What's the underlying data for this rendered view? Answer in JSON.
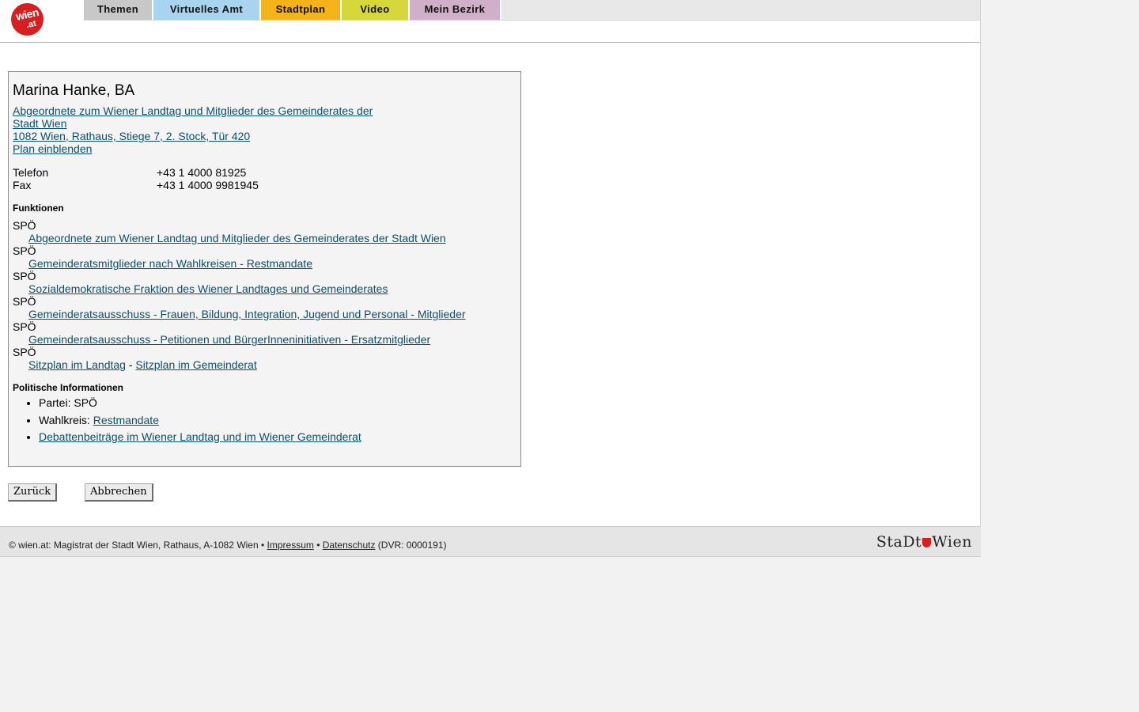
{
  "header": {
    "logo_text_top": "wien",
    "logo_text_bottom": ".at",
    "tabs": [
      {
        "label": "Themen",
        "color": "#c8c8c8"
      },
      {
        "label": "Virtuelles Amt",
        "color": "#a9d4f0"
      },
      {
        "label": "Stadtplan",
        "color": "#f5b31a"
      },
      {
        "label": "Video",
        "color": "#d6d83a"
      },
      {
        "label": "Mein Bezirk",
        "color": "#cfb0c8"
      }
    ]
  },
  "person": {
    "name": "Marina Hanke, BA",
    "org_line1": "Abgeordnete zum Wiener Landtag und Mitglieder des Gemeinderates der",
    "org_line2": "Stadt Wien ",
    "address": "1082 Wien, Rathaus, Stiege 7, 2. Stock, Tür 420",
    "map_link": "Plan einblenden",
    "phone_label": "Telefon",
    "phone": "+43 1 4000 81925",
    "fax_label": "Fax",
    "fax": "+43 1 4000 9981945"
  },
  "functions": {
    "title": "Funktionen",
    "items": [
      {
        "party": "SPÖ",
        "link": "Abgeordnete zum Wiener Landtag und Mitglieder des Gemeinderates der Stadt Wien"
      },
      {
        "party": "SPÖ",
        "link": "Gemeinderatsmitglieder nach Wahlkreisen - Restmandate"
      },
      {
        "party": "SPÖ",
        "link": "Sozialdemokratische Fraktion des Wiener Landtages und Gemeinderates"
      },
      {
        "party": "SPÖ",
        "link": "Gemeinderatsausschuss - Frauen, Bildung, Integration, Jugend und Personal - Mitglieder"
      },
      {
        "party": "SPÖ",
        "link": "Gemeinderatsausschuss - Petitionen und BürgerInneninitiativen - Ersatzmitglieder"
      },
      {
        "party": "SPÖ",
        "link": "Sitzplan im Landtag",
        "separator": " - ",
        "link2": "Sitzplan im Gemeinderat"
      }
    ]
  },
  "political": {
    "title": "Politische Informationen",
    "party_label": "Partei: ",
    "party_value": "SPÖ",
    "district_label": "Wahlkreis: ",
    "district_link": "Restmandate",
    "debates_link": "Debattenbeiträge im Wiener Landtag und im Wiener Gemeinderat"
  },
  "buttons": {
    "back": "Zurück",
    "cancel": "Abbrechen"
  },
  "footer": {
    "text_prefix": "© wien.at: Magistrat der Stadt Wien, Rathaus, A-1082 Wien • ",
    "impressum": "Impressum",
    "bullet": " • ",
    "datenschutz": "Datenschutz",
    "suffix": " (DVR: 0000191)",
    "logo_left": "StaDt",
    "logo_right": "Wien"
  }
}
